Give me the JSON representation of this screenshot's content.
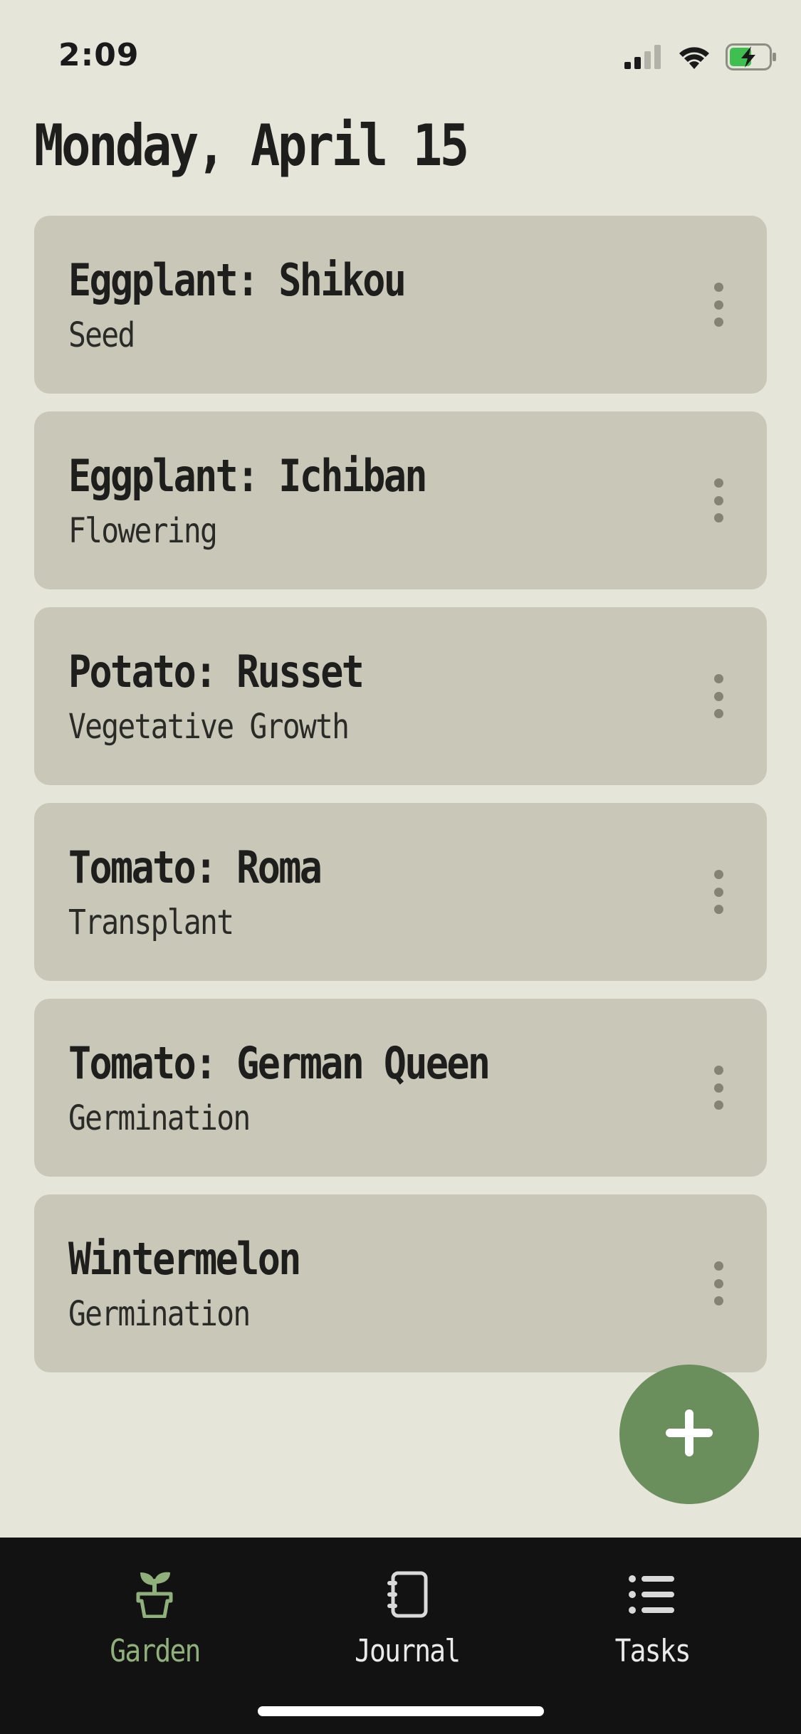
{
  "status_bar": {
    "time": "2:09"
  },
  "header": {
    "title": "Monday, April 15"
  },
  "plants": [
    {
      "name": "Eggplant: Shikou",
      "stage": "Seed"
    },
    {
      "name": "Eggplant: Ichiban",
      "stage": "Flowering"
    },
    {
      "name": "Potato: Russet",
      "stage": "Vegetative Growth"
    },
    {
      "name": "Tomato: Roma",
      "stage": "Transplant"
    },
    {
      "name": "Tomato: German Queen",
      "stage": "Germination"
    },
    {
      "name": "Wintermelon",
      "stage": "Germination"
    }
  ],
  "fab": {
    "icon": "plus-icon"
  },
  "bottom_nav": {
    "items": [
      {
        "label": "Garden",
        "icon": "sprout-pot-icon",
        "active": true
      },
      {
        "label": "Journal",
        "icon": "notebook-icon",
        "active": false
      },
      {
        "label": "Tasks",
        "icon": "list-icon",
        "active": false
      }
    ]
  },
  "colors": {
    "background": "#e6e5da",
    "card": "#c9c7b7",
    "accent": "#6b8e5d",
    "nav_active": "#8fb07a",
    "nav_bg": "#121212"
  }
}
